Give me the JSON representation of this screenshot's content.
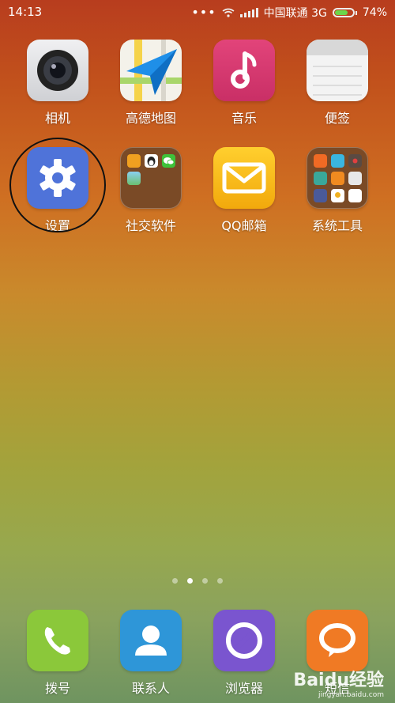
{
  "status": {
    "time": "14:13",
    "carrier": "中国联通 3G",
    "battery": "74%",
    "battery_level": 0.74
  },
  "apps_row1": [
    {
      "label": "相机",
      "icon": "camera-icon"
    },
    {
      "label": "高德地图",
      "icon": "map-navigation-icon"
    },
    {
      "label": "音乐",
      "icon": "music-note-icon"
    },
    {
      "label": "便签",
      "icon": "notes-icon"
    }
  ],
  "apps_row2": [
    {
      "label": "设置",
      "icon": "gear-icon"
    },
    {
      "label": "社交软件",
      "icon": "folder-icon"
    },
    {
      "label": "QQ邮箱",
      "icon": "mail-envelope-icon"
    },
    {
      "label": "系统工具",
      "icon": "folder-icon"
    }
  ],
  "dock": [
    {
      "label": "拨号",
      "icon": "phone-handset-icon"
    },
    {
      "label": "联系人",
      "icon": "contact-person-icon"
    },
    {
      "label": "浏览器",
      "icon": "browser-icon"
    },
    {
      "label": "短信",
      "icon": "message-bubble-icon"
    }
  ],
  "pager": {
    "count": 4,
    "active": 1
  },
  "annotation": {
    "color": "#111111",
    "target": "设置"
  },
  "watermark": {
    "text": "Baidu经验",
    "url": "jingyan.baidu.com"
  }
}
